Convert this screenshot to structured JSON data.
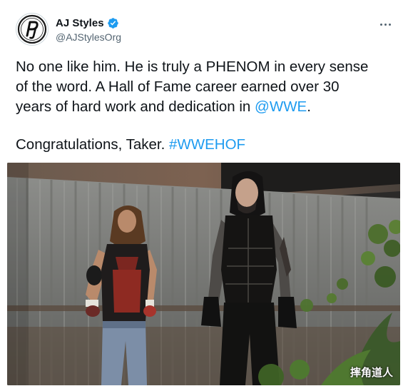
{
  "tweet": {
    "author": {
      "display_name": "AJ Styles",
      "handle": "@AJStylesOrg",
      "verified": true,
      "avatar_icon": "pj-logo-icon"
    },
    "more_icon": "more-dots-icon",
    "text": {
      "line1": "No one like him. He is truly a PHENOM in every sense",
      "line2": "of the word. A Hall of Fame career earned over 30",
      "line3_prefix": "years of hard work and dedication in ",
      "line3_mention": "@WWE",
      "line3_suffix": ".",
      "para2_prefix": "Congratulations, Taker. ",
      "para2_hashtag": "#WWEHOF"
    },
    "media": {
      "watermark": "摔角道人"
    },
    "colors": {
      "link": "#1d9bf0",
      "verified": "#1d9bf0",
      "text": "#0f1419",
      "secondary": "#536471"
    }
  }
}
